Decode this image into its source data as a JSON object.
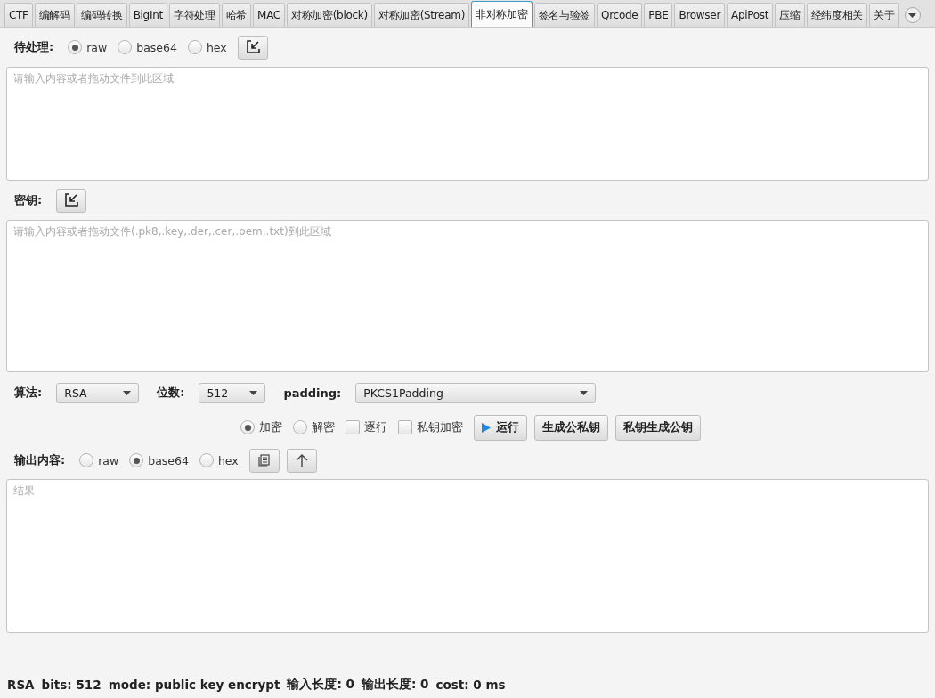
{
  "tabs": [
    {
      "label": "CTF",
      "selected": false
    },
    {
      "label": "编解码",
      "selected": false
    },
    {
      "label": "编码转换",
      "selected": false
    },
    {
      "label": "BigInt",
      "selected": false
    },
    {
      "label": "字符处理",
      "selected": false
    },
    {
      "label": "哈希",
      "selected": false
    },
    {
      "label": "MAC",
      "selected": false
    },
    {
      "label": "对称加密(block)",
      "selected": false
    },
    {
      "label": "对称加密(Stream)",
      "selected": false
    },
    {
      "label": "非对称加密",
      "selected": true
    },
    {
      "label": "签名与验签",
      "selected": false
    },
    {
      "label": "Qrcode",
      "selected": false
    },
    {
      "label": "PBE",
      "selected": false
    },
    {
      "label": "Browser",
      "selected": false
    },
    {
      "label": "ApiPost",
      "selected": false
    },
    {
      "label": "压缩",
      "selected": false
    },
    {
      "label": "经纬度相关",
      "selected": false
    },
    {
      "label": "关于",
      "selected": false
    }
  ],
  "input": {
    "label": "待处理:",
    "formats": [
      {
        "label": "raw",
        "selected": true
      },
      {
        "label": "base64",
        "selected": false
      },
      {
        "label": "hex",
        "selected": false
      }
    ],
    "placeholder": "请输入内容或者拖动文件到此区域"
  },
  "key": {
    "label": "密钥:",
    "placeholder": "请输入内容或者拖动文件(.pk8,.key,.der,.cer,.pem,.txt)到此区域"
  },
  "settings": [
    {
      "label": "算法:",
      "value": "RSA"
    },
    {
      "label": "位数:",
      "value": "512"
    },
    {
      "label": "padding:",
      "value": "PKCS1Padding"
    }
  ],
  "modes": [
    {
      "label": "加密",
      "selected": true
    },
    {
      "label": "解密",
      "selected": false
    }
  ],
  "options": [
    {
      "label": "逐行",
      "checked": false
    },
    {
      "label": "私钥加密",
      "checked": false
    }
  ],
  "actions": [
    {
      "label": "运行",
      "kind": "run"
    },
    {
      "label": "生成公私钥",
      "kind": "plain"
    },
    {
      "label": "私钥生成公钥",
      "kind": "plain"
    }
  ],
  "output": {
    "label": "输出内容:",
    "formats": [
      {
        "label": "raw",
        "selected": false
      },
      {
        "label": "base64",
        "selected": true
      },
      {
        "label": "hex",
        "selected": false
      }
    ],
    "placeholder": "结果"
  },
  "status_bar": [
    "RSA",
    "bits: 512",
    "mode: public key encrypt",
    "输入长度: 0",
    "输出长度: 0",
    "cost: 0 ms"
  ]
}
